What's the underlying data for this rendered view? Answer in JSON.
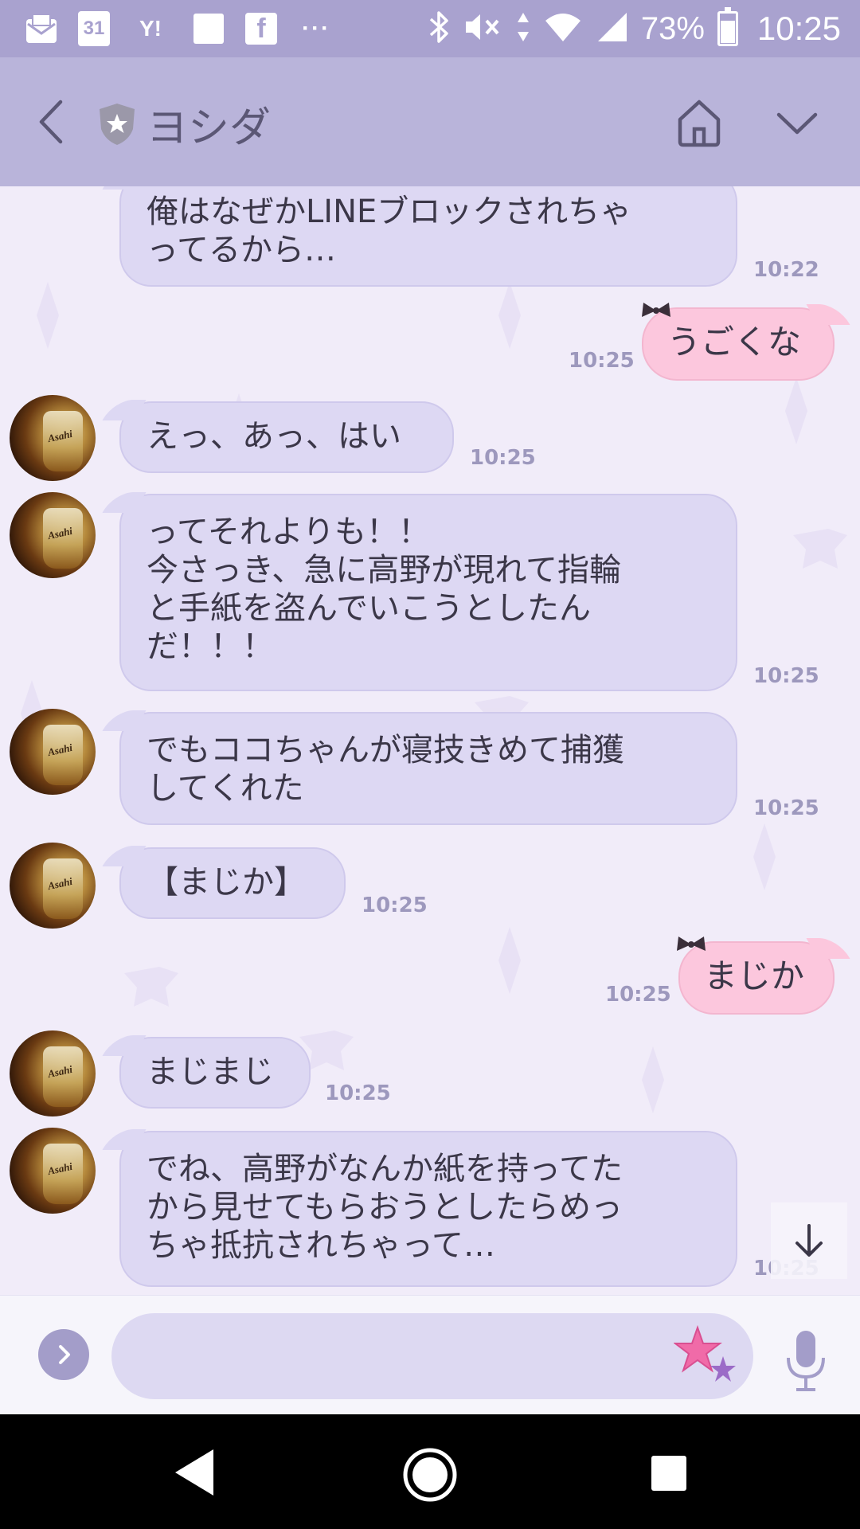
{
  "status_bar": {
    "yahoo_label": "Y!",
    "calendar_day": "31",
    "facebook_label": "f",
    "more_dots": "···",
    "battery_percent": "73%",
    "battery_level": 0.73,
    "time": "10:25"
  },
  "header": {
    "title": "ヨシダ"
  },
  "messages": [
    {
      "side": "in",
      "text": "俺はなぜかLINEブロックされちゃ\nってるから…",
      "time": "10:22"
    },
    {
      "side": "out",
      "text": "うごくな",
      "time": "10:25"
    },
    {
      "side": "in",
      "text": "えっ、あっ、はい",
      "time": "10:25"
    },
    {
      "side": "in",
      "text": "ってそれよりも！！\n今さっき、急に高野が現れて指輪\nと手紙を盗んでいこうとしたん\nだ！！！",
      "time": "10:25"
    },
    {
      "side": "in",
      "text": "でもココちゃんが寝技きめて捕獲\nしてくれた",
      "time": "10:25"
    },
    {
      "side": "in",
      "text": "【まじか】",
      "time": "10:25"
    },
    {
      "side": "out",
      "text": "まじか",
      "time": "10:25"
    },
    {
      "side": "in",
      "text": "まじまじ",
      "time": "10:25"
    },
    {
      "side": "in",
      "text": "でね、高野がなんか紙を持ってた\nから見せてもらおうとしたらめっ\nちゃ抵抗されちゃって…",
      "time": "10:25"
    }
  ],
  "avatar_logo": "Asahi",
  "input": {
    "placeholder": "",
    "value": ""
  },
  "colors": {
    "status_bar": "#a9a2cf",
    "header": "#b9b4da",
    "incoming_bubble": "#ddd8f3",
    "outgoing_bubble": "#fcc7dd",
    "timestamp": "#9d98bd"
  },
  "icons": {
    "back": "chevron-left-icon",
    "shield": "shield-star-icon",
    "home": "home-icon",
    "menu": "chevron-down-icon",
    "expand": "chevron-right-icon",
    "sticker": "star-sticker-icon",
    "mic": "microphone-icon",
    "scroll_down": "arrow-down-icon"
  }
}
